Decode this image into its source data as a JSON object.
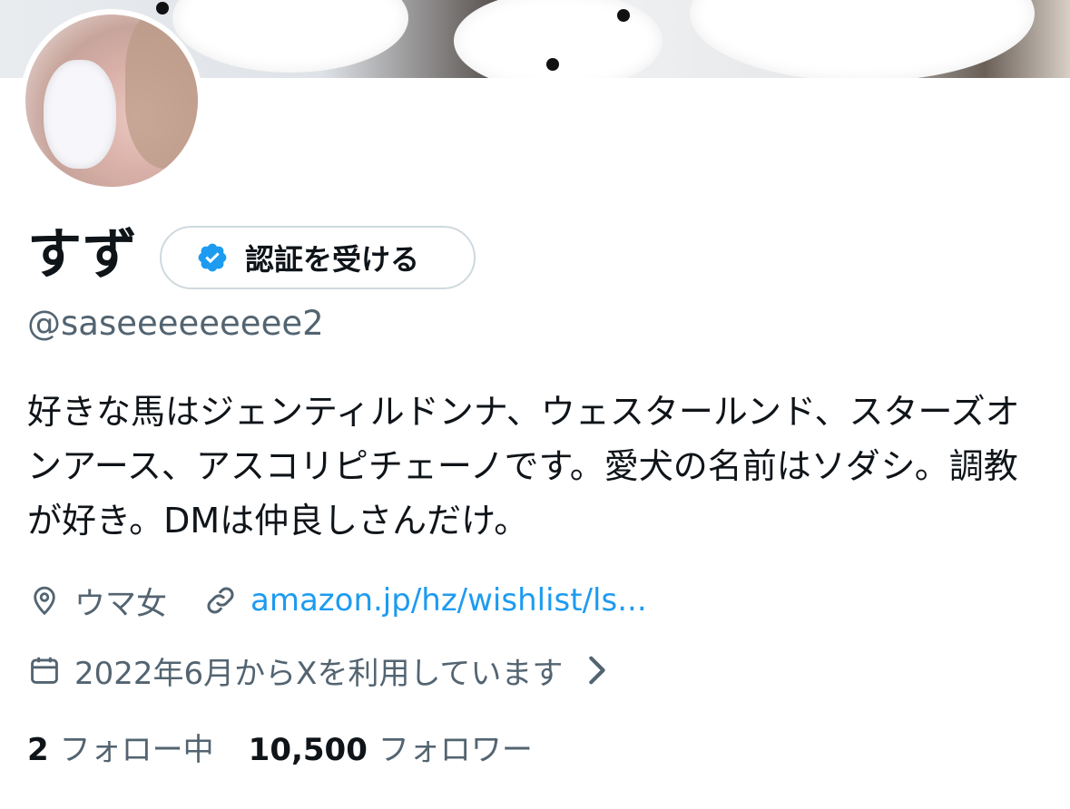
{
  "profile": {
    "display_name": "すず",
    "verify_button_label": "認証を受ける",
    "handle": "@saseeeeeeeee2",
    "bio": "好きな馬はジェンティルドンナ、ウェスタールンド、スターズオンアース、アスコリピチェーノです。愛犬の名前はソダシ。調教が好き。DMは仲良しさんだけ。",
    "location": "ウマ女",
    "website": "amazon.jp/hz/wishlist/ls...",
    "joined": "2022年6月からXを利用しています"
  },
  "stats": {
    "following_count": "2",
    "following_label": "フォロー中",
    "followers_count": "10,500",
    "followers_label": "フォロワー"
  },
  "icons": {
    "verify": "verified-badge-icon",
    "location": "location-pin-icon",
    "link": "link-icon",
    "calendar": "calendar-icon",
    "chevron": "chevron-right-icon"
  },
  "colors": {
    "accent": "#1d9bf0",
    "secondary_text": "#536471",
    "primary_text": "#0f1419",
    "border": "#cfd9de"
  }
}
